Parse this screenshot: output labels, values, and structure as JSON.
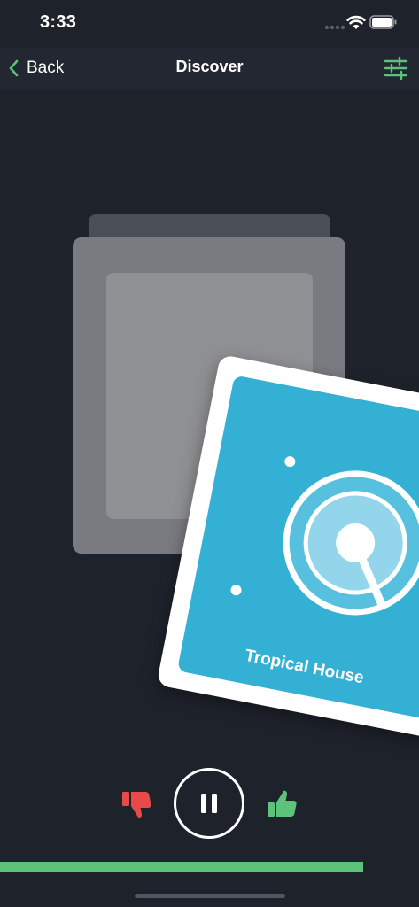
{
  "status_bar": {
    "time": "3:33"
  },
  "nav": {
    "back_label": "Back",
    "title": "Discover",
    "back_icon": "chevron-left-icon",
    "filter_icon": "sliders-icon"
  },
  "card": {
    "title": "Tropical House",
    "artwork_icon": "vinyl-record-icon"
  },
  "controls": {
    "dislike_icon": "thumbs-down-icon",
    "play_pause_icon": "pause-icon",
    "like_icon": "thumbs-up-icon",
    "progress_fraction": 0.866
  },
  "colors": {
    "background": "#1e222b",
    "nav_background": "#222731",
    "accent_green": "#5cc47a",
    "dislike_red": "#e84a4a",
    "card_blue": "#35b0d5"
  }
}
